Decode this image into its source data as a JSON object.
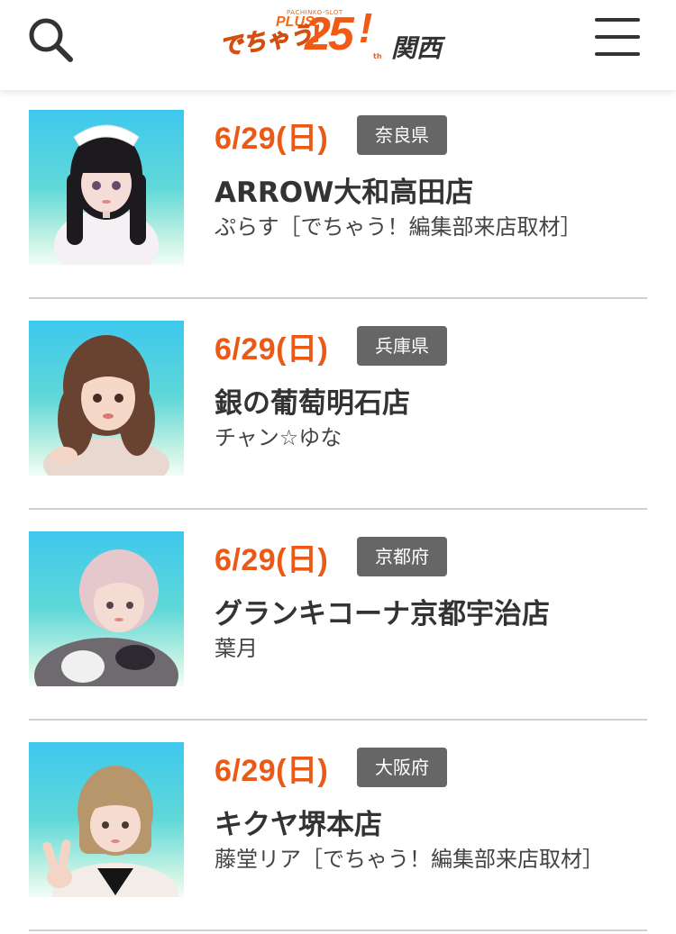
{
  "header": {
    "logo": {
      "sub_text": "PACHINKO-SLOT",
      "plus_text": "PLUS",
      "name_text": "でちゃう!",
      "number_text": "25",
      "exclaim_text": "!",
      "th_text": "th",
      "region_text": "関西"
    },
    "search_icon": "search-icon",
    "menu_icon": "hamburger-menu-icon"
  },
  "colors": {
    "accent": "#ea5a16",
    "badge_bg": "#666666",
    "divider": "#cfcfcf",
    "text": "#333333"
  },
  "items": [
    {
      "date": "6/29(日)",
      "prefecture": "奈良県",
      "store": "ARROW大和高田店",
      "talent": "ぷらす［でちゃう！編集部来店取材］"
    },
    {
      "date": "6/29(日)",
      "prefecture": "兵庫県",
      "store": "銀の葡萄明石店",
      "talent": "チャン☆ゆな"
    },
    {
      "date": "6/29(日)",
      "prefecture": "京都府",
      "store": "グランキコーナ京都宇治店",
      "talent": "葉月"
    },
    {
      "date": "6/29(日)",
      "prefecture": "大阪府",
      "store": "キクヤ堺本店",
      "talent": "藤堂リア［でちゃう！編集部来店取材］"
    }
  ]
}
